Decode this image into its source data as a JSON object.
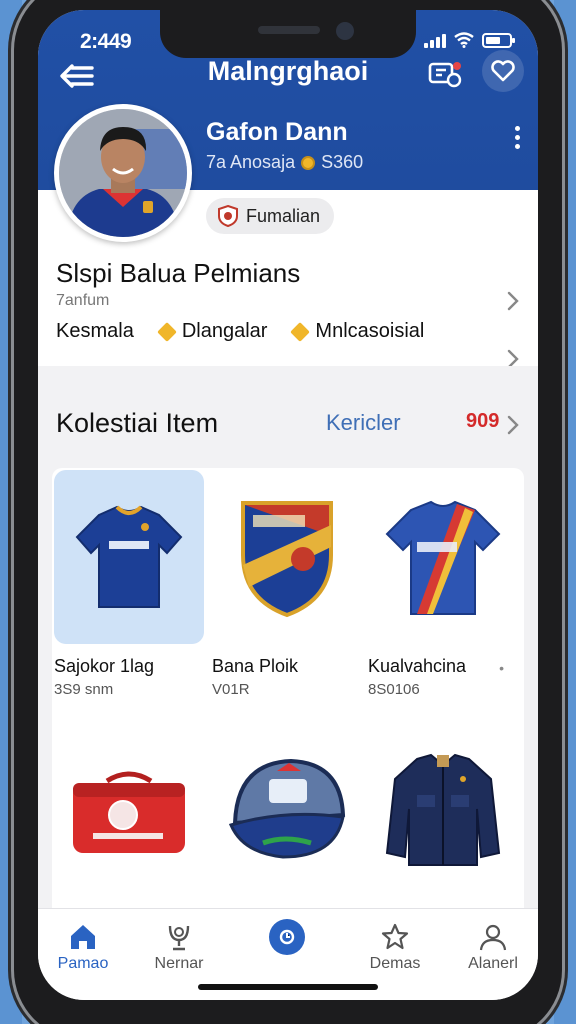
{
  "status": {
    "time": "2:449"
  },
  "header": {
    "title": "Malngrghaoi",
    "back_icon": "back-arrow-icon",
    "share_icon": "share-icon",
    "favorite_icon": "heart-icon"
  },
  "profile": {
    "name": "Gafon Dann",
    "meta_left": "7a Anosaja",
    "meta_right": "S360",
    "badge_label": "Fumalian",
    "more_icon": "more-vertical-icon"
  },
  "summary": {
    "title": "Slspi Balua Pelmians",
    "subtitle": "7anfum",
    "chips": [
      "Kesmala",
      "Dlangalar",
      "Mnlcasoisial"
    ]
  },
  "collection": {
    "title": "Kolestiai Item",
    "link": "Kericler",
    "count": "909"
  },
  "items": [
    {
      "name": "Sajokor 1lag",
      "sub": "3S9 snm"
    },
    {
      "name": "Bana Ploik",
      "sub": "V01R"
    },
    {
      "name": "Kualvahcina",
      "sub": "8S0106"
    },
    {
      "name": "",
      "sub": ""
    },
    {
      "name": "",
      "sub": ""
    },
    {
      "name": "",
      "sub": ""
    }
  ],
  "tabs": [
    {
      "label": "Pamao",
      "icon": "home-icon"
    },
    {
      "label": "Nernar",
      "icon": "trophy-icon"
    },
    {
      "label": "",
      "icon": "center-action-icon"
    },
    {
      "label": "Demas",
      "icon": "star-icon"
    },
    {
      "label": "Alanerl",
      "icon": "profile-icon"
    }
  ],
  "colors": {
    "header": "#2150a6",
    "accent": "#2a63c2",
    "count": "#d42a2a"
  }
}
